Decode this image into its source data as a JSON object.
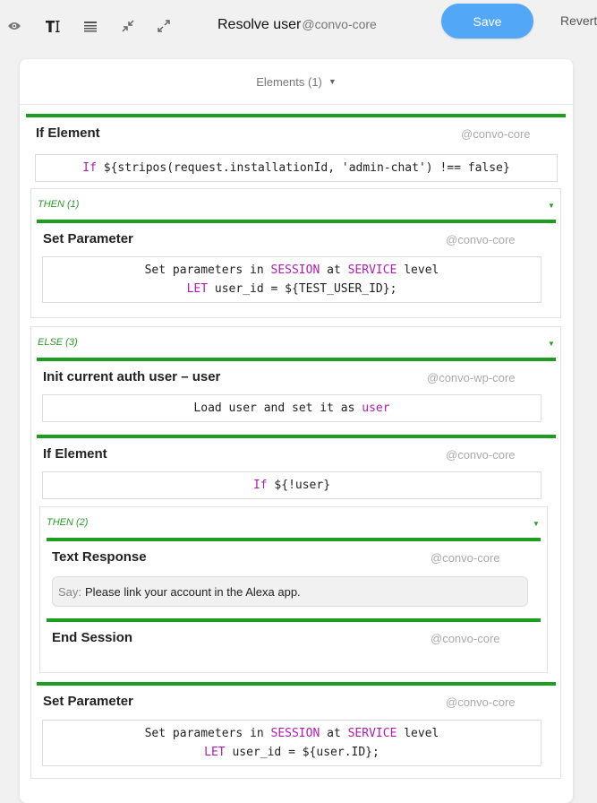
{
  "toolbar": {
    "icons": [
      "eye-icon",
      "text-icon",
      "list-icon",
      "compress-icon",
      "expand-icon"
    ],
    "title": "Resolve user",
    "package": "@convo-core",
    "save_label": "Save",
    "revert_label": "Revert"
  },
  "panel": {
    "header": "Elements (1)"
  },
  "root_if": {
    "name": "If Element",
    "package": "@convo-core",
    "cond_kw": "If",
    "cond_text": " ${stripos(request.installationId, 'admin-chat') !== false}"
  },
  "then1": {
    "label": "THEN (1)",
    "set_param": {
      "name": "Set Parameter",
      "package": "@convo-core",
      "l1_a": "Set parameters in ",
      "l1_kw1": "SESSION",
      "l1_b": " at ",
      "l1_kw2": "SERVICE",
      "l1_c": " level",
      "l2_kw": "LET",
      "l2_text": " user_id = ${TEST_USER_ID};"
    }
  },
  "else3": {
    "label": "ELSE (3)",
    "init_auth": {
      "name": "Init current auth user – user",
      "package": "@convo-wp-core",
      "text": "Load user and set it as ",
      "kw": "user"
    },
    "if_el": {
      "name": "If Element",
      "package": "@convo-core",
      "cond_kw": "If",
      "cond_text": " ${!user}",
      "then": {
        "label": "THEN (2)",
        "text_response": {
          "name": "Text Response",
          "package": "@convo-core",
          "say_label": "Say:",
          "say_text": "Please link your account in the Alexa app."
        },
        "end_session": {
          "name": "End Session",
          "package": "@convo-core"
        }
      }
    },
    "set_param": {
      "name": "Set Parameter",
      "package": "@convo-core",
      "l1_a": "Set parameters in ",
      "l1_kw1": "SESSION",
      "l1_b": " at ",
      "l1_kw2": "SERVICE",
      "l1_c": " level",
      "l2_kw": "LET",
      "l2_text": " user_id = ${user.ID};"
    }
  }
}
